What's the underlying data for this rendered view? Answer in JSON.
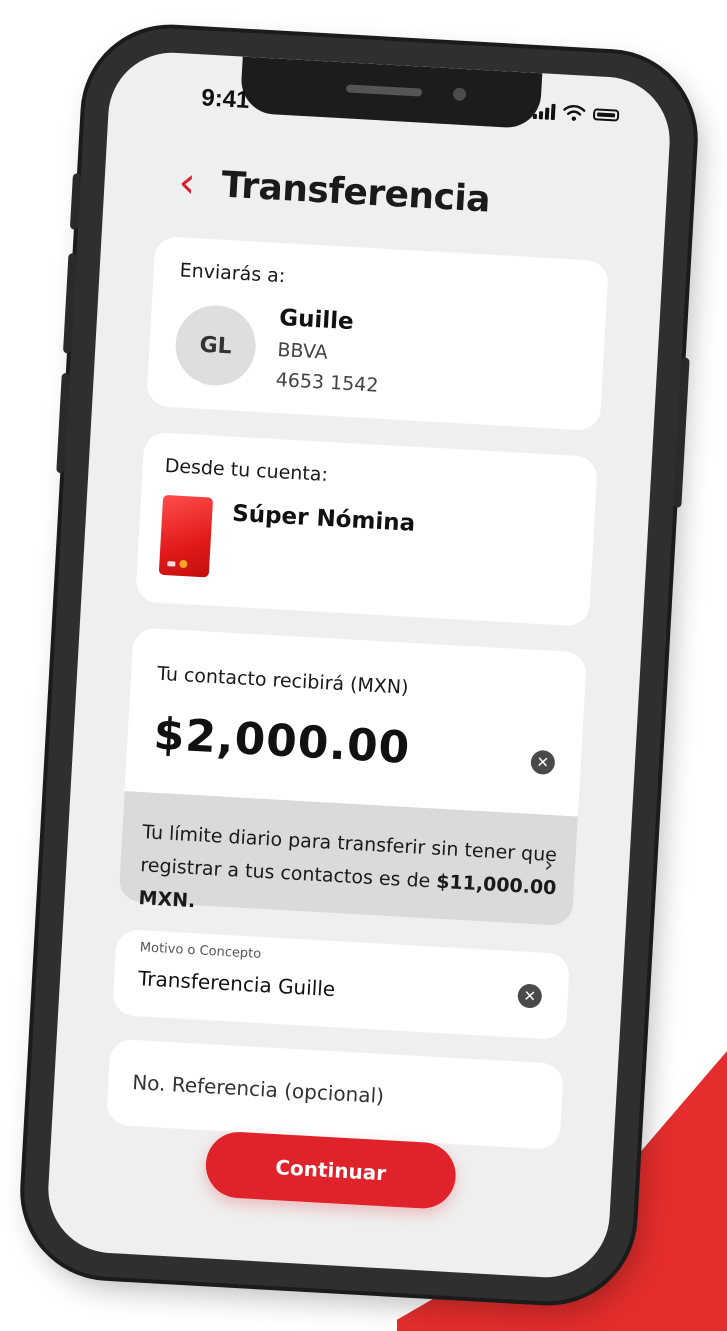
{
  "status": {
    "time": "9:41"
  },
  "header": {
    "title": "Transferencia"
  },
  "recipient": {
    "label": "Enviarás a:",
    "initials": "GL",
    "name": "Guille",
    "bank": "BBVA",
    "account": "4653 1542"
  },
  "source": {
    "label": "Desde tu cuenta:",
    "account_name": "Súper Nómina"
  },
  "amount": {
    "label": "Tu contacto recibirá (MXN)",
    "value": "$2,000.00"
  },
  "limit": {
    "text": "Tu límite diario para transferir sin tener que registrar a tus contactos es de ",
    "amount": "$11,000.00 MXN."
  },
  "concept": {
    "label": "Motivo o Concepto",
    "value": "Transferencia Guille"
  },
  "reference": {
    "placeholder": "No. Referencia (opcional)"
  },
  "actions": {
    "continue_label": "Continuar"
  },
  "colors": {
    "accent": "#e0222b",
    "back_arrow": "#d81e2a"
  }
}
